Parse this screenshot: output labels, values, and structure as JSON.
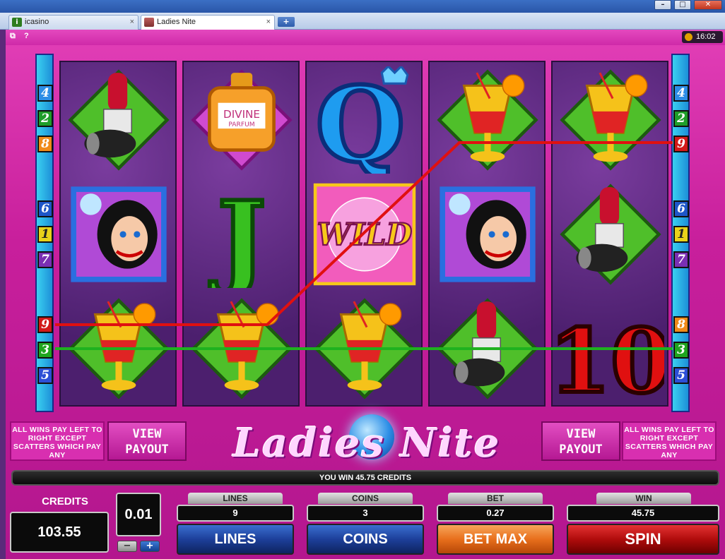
{
  "browser": {
    "tabs": [
      {
        "label": "icasino",
        "close": "×"
      },
      {
        "label": "Ladies Nite",
        "close": "×"
      }
    ],
    "new_tab": "+",
    "window_buttons": [
      "–",
      "□",
      "✕"
    ]
  },
  "game": {
    "toolbar": {
      "help": "?",
      "clock": "16:02"
    },
    "logo": "Ladies Nite",
    "rules_text": "ALL WINS PAY LEFT TO RIGHT EXCEPT SCATTERS WHICH PAY ANY",
    "view_payout": "VIEW PAYOUT",
    "win_message": "YOU WIN 45.75 CREDITS",
    "left_paylines": [
      "4",
      "2",
      "8",
      "6",
      "1",
      "7",
      "9",
      "3",
      "5"
    ],
    "right_paylines": [
      "4",
      "2",
      "9",
      "6",
      "1",
      "7",
      "8",
      "3",
      "5"
    ],
    "payline_colors": {
      "red": "#e01010",
      "green": "#1fb11f"
    },
    "reels": [
      [
        "lipstick",
        "lady",
        "cocktail"
      ],
      [
        "perfume",
        "J",
        "cocktail"
      ],
      [
        "Q",
        "wild",
        "cocktail"
      ],
      [
        "cocktail",
        "lady",
        "lipstick"
      ],
      [
        "cocktail",
        "lipstick",
        "10"
      ]
    ],
    "symbol_text": {
      "perfume_brand": "DIVINE",
      "perfume_sub": "PARFUM",
      "wild": "WILD",
      "j": "J",
      "q": "Q",
      "ten": "10"
    }
  },
  "controls": {
    "credits_label": "CREDITS",
    "credits_value": "103.55",
    "denomination": "0.01",
    "minus": "−",
    "plus": "+",
    "lines": {
      "label": "LINES",
      "value": "9",
      "button": "LINES"
    },
    "coins": {
      "label": "COINS",
      "value": "3",
      "button": "COINS"
    },
    "bet": {
      "label": "BET",
      "value": "0.27",
      "button": "BET MAX"
    },
    "win": {
      "label": "WIN",
      "value": "45.75",
      "button": "SPIN"
    }
  }
}
